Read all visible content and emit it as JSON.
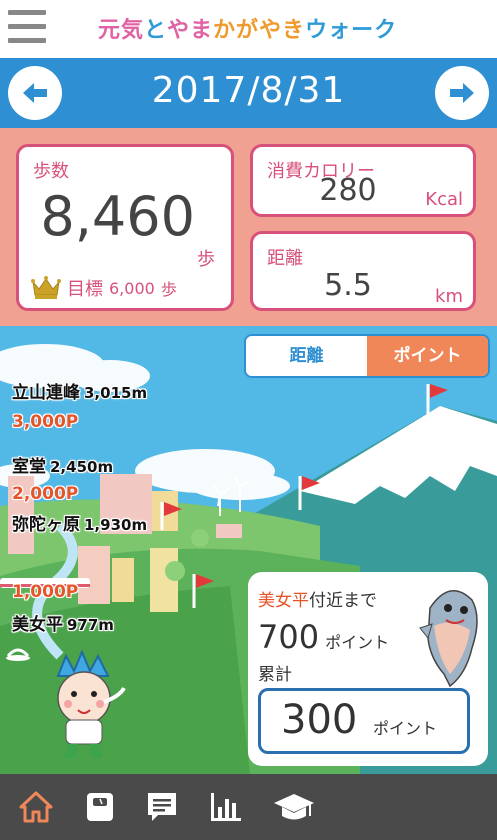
{
  "header": {
    "menu_icon": "hamburger-menu-icon",
    "title_parts": [
      "元気",
      "と",
      "やま",
      "かがやき",
      "ウォーク"
    ],
    "colors": [
      "#e062a4",
      "#2e9ad8",
      "#e062a4",
      "#f09a2e",
      "#2e9ad8"
    ]
  },
  "date_bar": {
    "date": "2017/8/31",
    "prev_icon": "arrow-left-icon",
    "next_icon": "arrow-right-icon"
  },
  "stats": {
    "steps": {
      "label": "歩数",
      "value": "8,460",
      "unit": "歩"
    },
    "goal": {
      "icon": "crown-icon",
      "label": "目標",
      "value": "6,000",
      "unit": "歩"
    },
    "calories": {
      "label": "消費カロリー",
      "value": "280",
      "unit": "Kcal"
    },
    "distance": {
      "label": "距離",
      "value": "5.5",
      "unit": "km"
    }
  },
  "view_toggle": {
    "distance_label": "距離",
    "point_label": "ポイント",
    "selected": "point"
  },
  "milestones": [
    {
      "name": "立山連峰",
      "elevation": "3,015m",
      "points": "3,000P"
    },
    {
      "name": "室堂",
      "elevation": "2,450m",
      "points": "2,000P"
    },
    {
      "name": "弥陀ヶ原",
      "elevation": "1,930m",
      "points": "1,000P"
    },
    {
      "name": "美女平",
      "elevation": "977m"
    }
  ],
  "progress_info": {
    "next_place": "美女平",
    "next_suffix": "付近まで",
    "remaining_value": "700",
    "remaining_unit": "ポイント",
    "total_label": "累計",
    "total_value": "300",
    "total_unit": "ポイント"
  },
  "bottom_nav": [
    {
      "icon": "home-icon",
      "active": true
    },
    {
      "icon": "scale-icon",
      "active": false
    },
    {
      "icon": "message-icon",
      "active": false
    },
    {
      "icon": "bar-chart-icon",
      "active": false
    },
    {
      "icon": "graduation-cap-icon",
      "active": false
    }
  ],
  "colors": {
    "brand_blue": "#2f8fd3",
    "accent_pink": "#d7517a",
    "stats_bg": "#f1a191",
    "point_orange": "#ef8758",
    "nav_bg": "#4a4a4a",
    "active_nav": "#ef8758"
  }
}
